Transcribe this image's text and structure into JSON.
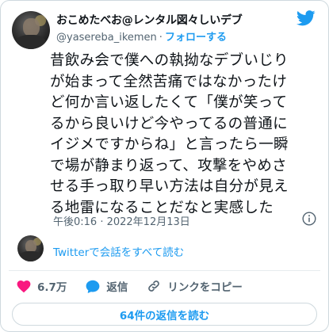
{
  "author": {
    "display_name": "おこめたべお@レンタル図々しいデブ",
    "handle": "@yasereba_ikemen",
    "separator": "·",
    "follow_label": "フォローする"
  },
  "tweet": {
    "text": "昔飲み会で僕への執拗なデブいじり\nが始まって全然苦痛ではなかったけ\nど何か言い返したくて「僕が笑って\nるから良いけど今やってるの普通に\nイジメですからね」と言ったら一瞬\nで場が静まり返って、攻撃をやめさ\nせる手っ取り早い方法は自分が見え\nる地雷になることだなと実感した",
    "timestamp": "午後0:16 · 2022年12月13日"
  },
  "reply_thread": {
    "link_label": "Twitterで会話をすべて読む"
  },
  "actions": {
    "like_count": "6.7万",
    "reply_label": "返信",
    "copy_link_label": "リンクをコピー"
  },
  "read_replies_label": "64件の返信を読む",
  "colors": {
    "accent": "#1d9bf0",
    "like": "#f91880",
    "text": "#0f1419",
    "muted": "#536471",
    "border": "#cfd9de"
  },
  "icons": {
    "logo": "twitter-bird-icon",
    "info": "info-icon",
    "like": "heart-icon",
    "reply": "speech-bubble-icon",
    "copy": "link-icon"
  }
}
